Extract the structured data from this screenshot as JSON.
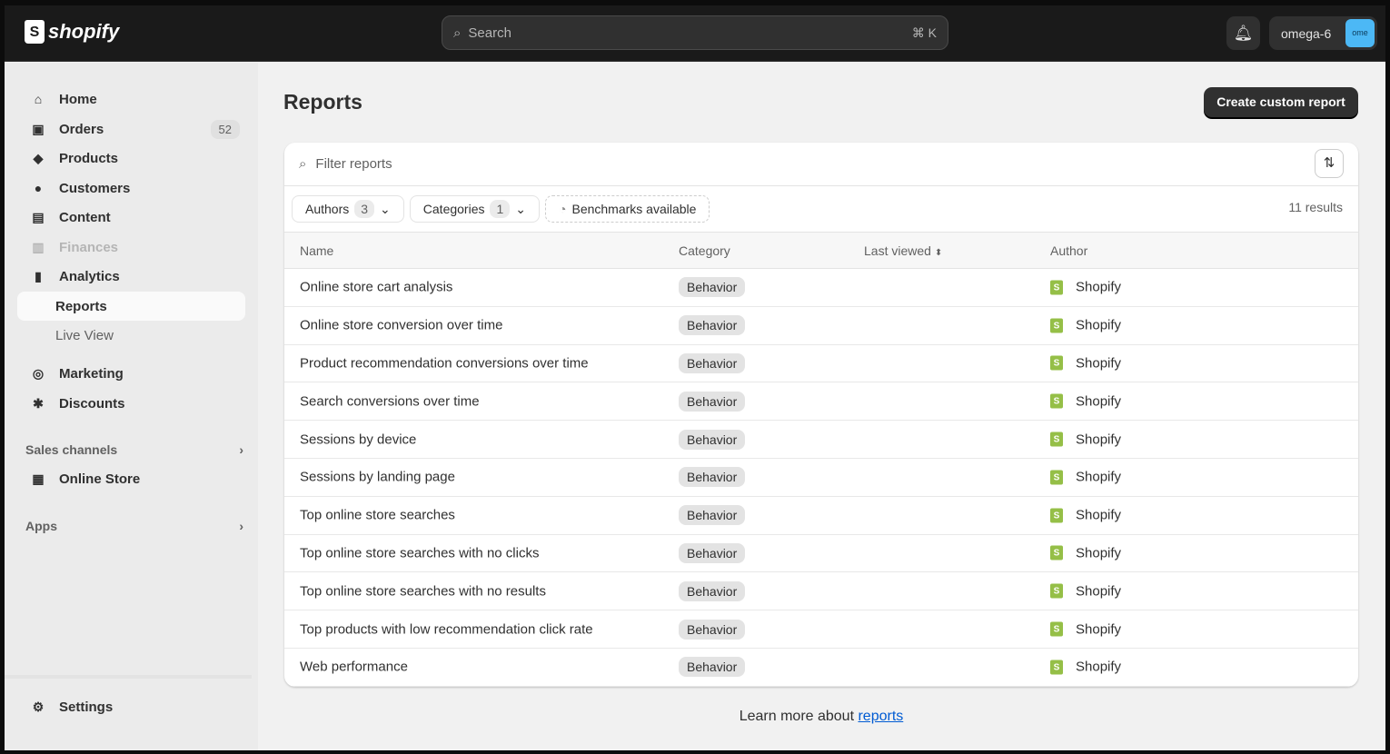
{
  "brand": "shopify",
  "search": {
    "placeholder": "Search",
    "shortcut": "⌘ K"
  },
  "user": {
    "name": "omega-6",
    "initials": "ome"
  },
  "sidebar": {
    "items": [
      {
        "label": "Home",
        "icon": "⌂"
      },
      {
        "label": "Orders",
        "icon": "▣",
        "badge": "52"
      },
      {
        "label": "Products",
        "icon": "◆"
      },
      {
        "label": "Customers",
        "icon": "●"
      },
      {
        "label": "Content",
        "icon": "▤"
      },
      {
        "label": "Finances",
        "icon": "▥"
      },
      {
        "label": "Analytics",
        "icon": "▮"
      },
      {
        "label": "Reports"
      },
      {
        "label": "Live View"
      },
      {
        "label": "Marketing",
        "icon": "◎"
      },
      {
        "label": "Discounts",
        "icon": "✱"
      }
    ],
    "sales_channels": "Sales channels",
    "online_store": "Online Store",
    "apps": "Apps",
    "settings": "Settings"
  },
  "page": {
    "title": "Reports",
    "create_label": "Create custom report",
    "filter_placeholder": "Filter reports",
    "chips": {
      "authors": "Authors",
      "authors_count": "3",
      "categories": "Categories",
      "categories_count": "1",
      "benchmarks": "Benchmarks available"
    },
    "results": "11 results",
    "columns": [
      "Name",
      "Category",
      "Last viewed",
      "Author"
    ],
    "rows": [
      {
        "name": "Online store cart analysis",
        "category": "Behavior",
        "author": "Shopify"
      },
      {
        "name": "Online store conversion over time",
        "category": "Behavior",
        "author": "Shopify"
      },
      {
        "name": "Product recommendation conversions over time",
        "category": "Behavior",
        "author": "Shopify"
      },
      {
        "name": "Search conversions over time",
        "category": "Behavior",
        "author": "Shopify"
      },
      {
        "name": "Sessions by device",
        "category": "Behavior",
        "author": "Shopify"
      },
      {
        "name": "Sessions by landing page",
        "category": "Behavior",
        "author": "Shopify"
      },
      {
        "name": "Top online store searches",
        "category": "Behavior",
        "author": "Shopify"
      },
      {
        "name": "Top online store searches with no clicks",
        "category": "Behavior",
        "author": "Shopify"
      },
      {
        "name": "Top online store searches with no results",
        "category": "Behavior",
        "author": "Shopify"
      },
      {
        "name": "Top products with low recommendation click rate",
        "category": "Behavior",
        "author": "Shopify"
      },
      {
        "name": "Web performance",
        "category": "Behavior",
        "author": "Shopify"
      }
    ],
    "learn_text": "Learn more about ",
    "learn_link": "reports"
  }
}
